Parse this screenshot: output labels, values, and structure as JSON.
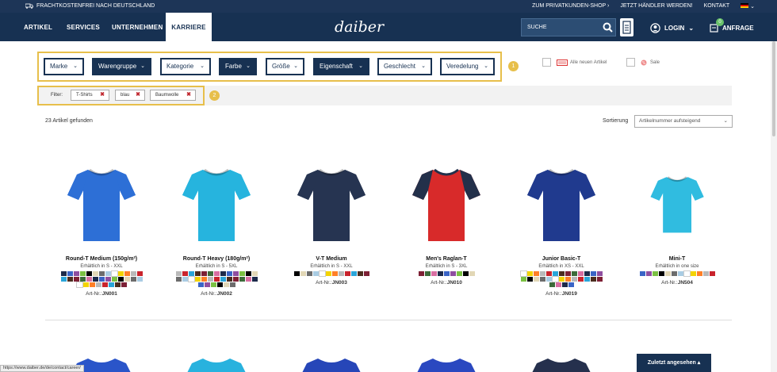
{
  "topbar": {
    "shipping": "FRACHTKOSTENFREI NACH DEUTSCHLAND",
    "privat": "ZUM PRIVATKUNDEN-SHOP",
    "haendler": "JETZT HÄNDLER WERDEN!",
    "kontakt": "KONTAKT"
  },
  "nav": {
    "items": [
      "ARTIKEL",
      "SERVICES",
      "UNTERNEHMEN",
      "KARRIERE"
    ],
    "active": "KARRIERE",
    "logo": "daiber",
    "search_placeholder": "SUCHE",
    "login": "LOGIN",
    "anfrage": "ANFRAGE",
    "anfrage_count": "0"
  },
  "filters": [
    "Marke",
    "Warengruppe",
    "Kategorie",
    "Farbe",
    "Größe",
    "Eigenschaft",
    "Geschlecht",
    "Veredelung"
  ],
  "filter_active": [
    "Warengruppe",
    "Farbe",
    "Eigenschaft"
  ],
  "annot": {
    "one": "1",
    "two": "2"
  },
  "checks": {
    "neu": "Alle neuen Artikel",
    "sale": "Sale"
  },
  "active_filter": {
    "label": "Filter:",
    "tags": [
      "T-Shirts",
      "blau",
      "Baumwolle"
    ]
  },
  "results": {
    "count": "23 Artikel gefunden",
    "sort_label": "Sortierung",
    "sort_value": "Artikelnummer aufsteigend"
  },
  "products": [
    {
      "name": "Round-T Medium (150g/m²)",
      "avail": "Erhältlich in S - XXL",
      "art_prefix": "Art-Nr.:",
      "art": "JN001",
      "body": "#2d6fd6",
      "sleeve": "#2d6fd6",
      "swatches": 34
    },
    {
      "name": "Round-T Heavy (180g/m²)",
      "avail": "Erhältlich in S - 5XL",
      "art_prefix": "Art-Nr.:",
      "art": "JN002",
      "body": "#26b4de",
      "sleeve": "#26b4de",
      "swatches": 32
    },
    {
      "name": "V-T Medium",
      "avail": "Erhältlich in S - XXL",
      "art_prefix": "Art-Nr.:",
      "art": "JN003",
      "body": "#263451",
      "sleeve": "#263451",
      "swatches": 12
    },
    {
      "name": "Men's Raglan-T",
      "avail": "Erhältlich in S - 3XL",
      "art_prefix": "Art-Nr.:",
      "art": "JN010",
      "body": "#d82a2a",
      "sleeve": "#23304a",
      "swatches": 9
    },
    {
      "name": "Junior Basic-T",
      "avail": "Erhältlich in XS - XXL",
      "art_prefix": "Art-Nr.:",
      "art": "JN019",
      "body": "#203a8e",
      "sleeve": "#203a8e",
      "swatches": 30
    },
    {
      "name": "Mini-T",
      "avail": "Erhältlich in one size",
      "art_prefix": "Art-Nr.:",
      "art": "JN504",
      "body": "#30bce0",
      "sleeve": "#30bce0",
      "swatches": 12
    }
  ],
  "swatch_colors": [
    "#1c2a4a",
    "#b9b9b9",
    "#000000",
    "#7d2035",
    "#ffffff",
    "#3a64c6",
    "#c9232c",
    "#e2d7b6",
    "#3c6b3a",
    "#f3d300",
    "#8f4ea0",
    "#2aa5d9",
    "#6c6c6c",
    "#d86ea2",
    "#ff7f27",
    "#7bc143",
    "#4b2d1f",
    "#a9cce3"
  ],
  "footer": {
    "status_url": "https://www.daiber.de/de/contact/career/",
    "recent": "Zuletzt angesehen"
  }
}
